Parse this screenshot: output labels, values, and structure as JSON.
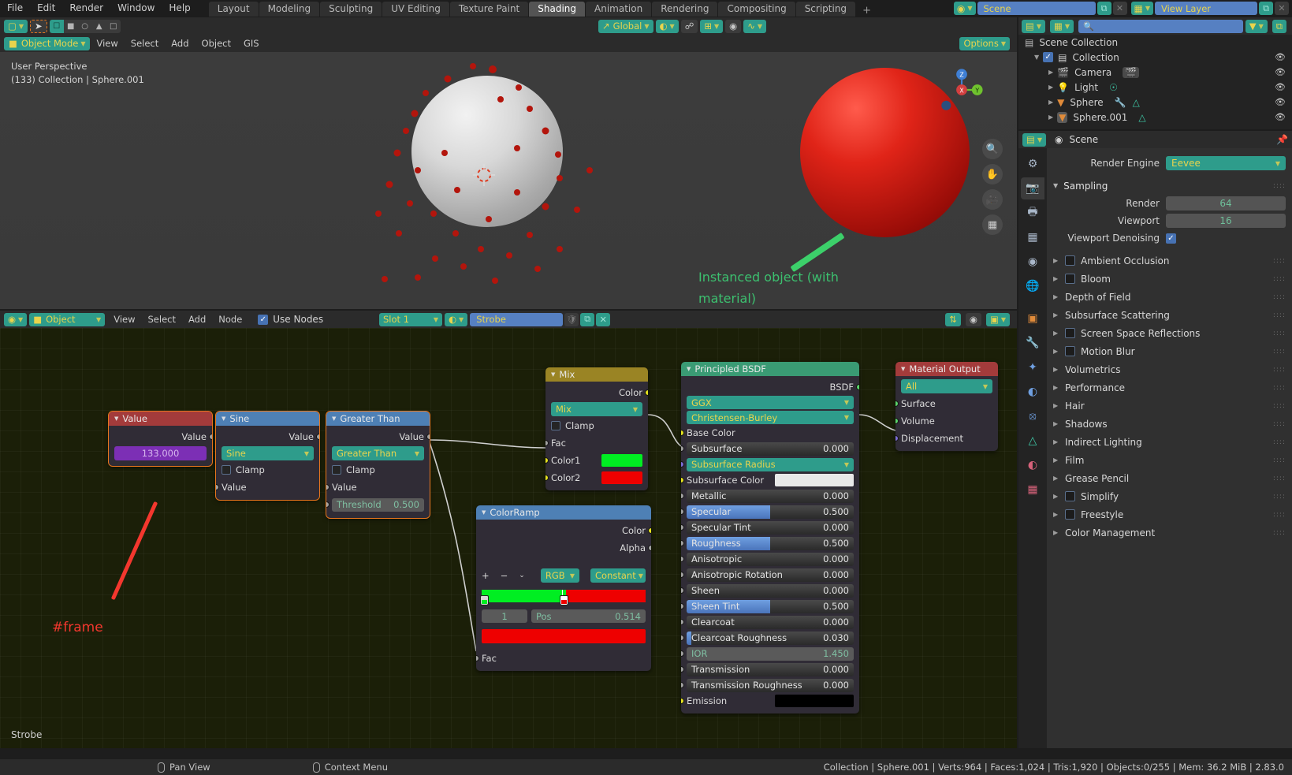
{
  "topbar": {
    "menus": [
      "File",
      "Edit",
      "Render",
      "Window",
      "Help"
    ],
    "workspaces": [
      "Layout",
      "Modeling",
      "Sculpting",
      "UV Editing",
      "Texture Paint",
      "Shading",
      "Animation",
      "Rendering",
      "Compositing",
      "Scripting"
    ],
    "active_workspace": "Shading",
    "add_workspace": "+",
    "scene_name": "Scene",
    "view_layer_name": "View Layer",
    "scene_icon": "scene-icon",
    "view_layer_icon": "view-layer-icon",
    "copy_icon": "duplicate-icon",
    "close_icon": "close-icon"
  },
  "viewport": {
    "header": {
      "editor_type_icon": "editor-type-3dview-icon",
      "cursor_icon": "select-cursor-icon",
      "select_modes": [
        "tweak-icon",
        "box-select-icon",
        "circle-select-icon",
        "lasso-select-icon",
        "select-extend-icon"
      ],
      "transform_orientation": "Global",
      "pivot_icon": "pivot-point-icon",
      "snap_icon": "snap-magnet-icon",
      "snap_target_icon": "snap-target-icon",
      "proportional_icon": "proportional-edit-icon",
      "proportional_falloff_icon": "falloff-curve-icon",
      "options_label": "Options",
      "visibility_icon": "object-visibility-icon",
      "gizmo_icon": "gizmo-icon",
      "overlays_icon": "overlays-icon",
      "xray_icon": "xray-toggle-icon",
      "shading_modes": [
        "wireframe-shading-icon",
        "solid-shading-icon",
        "material-preview-icon",
        "rendered-shading-icon"
      ]
    },
    "header2": {
      "mode": "Object Mode",
      "menus": [
        "View",
        "Select",
        "Add",
        "Object",
        "GIS"
      ]
    },
    "info_line1": "User Perspective",
    "info_line2": "(133) Collection | Sphere.001",
    "annotation": "Instanced object (with material)",
    "annotation_color": "#3cc06f",
    "gizmo_axes": [
      "Z",
      "Y",
      "X"
    ],
    "side_buttons": [
      "zoom-icon",
      "pan-hand-icon",
      "camera-view-icon",
      "ortho-persp-icon"
    ]
  },
  "shader_editor": {
    "header": {
      "editor_type_icon": "editor-type-shader-icon",
      "shader_type": "Object",
      "menus": [
        "View",
        "Select",
        "Add",
        "Node"
      ],
      "use_nodes_label": "Use Nodes",
      "use_nodes_checked": true,
      "slot": "Slot 1",
      "material_icon": "material-icon",
      "material_name": "Strobe",
      "shield_icon": "fake-user-icon",
      "new_material_icon": "new-material-icon",
      "unlink_icon": "unlink-icon",
      "snap_icon": "snap-icon",
      "overlay_icon": "node-overlay-icon",
      "pin_icon": "pin-icon"
    },
    "footer_label": "Strobe",
    "annotation_text": "#frame",
    "annotation_color": "#f4372e",
    "nodes": [
      {
        "name": "Value",
        "header_color": "#a33b3b",
        "selected": true,
        "outputs": [
          {
            "label": "Value",
            "socket": "grey"
          }
        ],
        "value_field": "133.000"
      },
      {
        "name": "Sine",
        "header_color": "#4e80b5",
        "selected": true,
        "outputs": [
          {
            "label": "Value",
            "socket": "grey"
          }
        ],
        "operation": "Sine",
        "clamp_label": "Clamp",
        "clamp_checked": false,
        "inputs": [
          {
            "label": "Value",
            "socket": "grey"
          }
        ]
      },
      {
        "name": "Greater Than",
        "header_color": "#4e80b5",
        "selected": true,
        "outputs": [
          {
            "label": "Value",
            "socket": "grey"
          }
        ],
        "operation": "Greater Than",
        "clamp_label": "Clamp",
        "clamp_checked": false,
        "inputs": [
          {
            "label": "Value",
            "socket": "grey"
          }
        ],
        "threshold_label": "Threshold",
        "threshold_value": "0.500"
      },
      {
        "name": "Mix",
        "header_color": "#9a8424",
        "selected": false,
        "outputs": [
          {
            "label": "Color",
            "socket": "yellow"
          }
        ],
        "blend_mode": "Mix",
        "clamp_label": "Clamp",
        "clamp_checked": false,
        "inputs": [
          {
            "label": "Fac",
            "socket": "grey"
          },
          {
            "label": "Color1",
            "socket": "yellow",
            "color": "#00ee22"
          },
          {
            "label": "Color2",
            "socket": "yellow",
            "color": "#ee0000"
          }
        ]
      },
      {
        "name": "ColorRamp",
        "header_color": "#4e80b5",
        "selected": false,
        "outputs": [
          {
            "label": "Color",
            "socket": "yellow"
          },
          {
            "label": "Alpha",
            "socket": "grey"
          }
        ],
        "tools": [
          "+",
          "−",
          "⌄"
        ],
        "color_mode": "RGB",
        "interpolation": "Constant",
        "stop_index": "1",
        "pos_label": "Pos",
        "pos_value": "0.514",
        "stop_color": "#ee0000",
        "ramp_left_color": "#00ee22",
        "ramp_right_color": "#ee0000",
        "ramp_split": 0.514,
        "inputs": [
          {
            "label": "Fac",
            "socket": "grey"
          }
        ]
      },
      {
        "name": "Principled BSDF",
        "header_color": "#3a9b74",
        "selected": false,
        "outputs": [
          {
            "label": "BSDF",
            "socket": "green"
          }
        ],
        "distribution": "GGX",
        "subsurface_method": "Christensen-Burley",
        "properties": [
          {
            "label": "Base Color",
            "type": "socket",
            "socket": "yellow"
          },
          {
            "label": "Subsurface",
            "type": "slider",
            "value": "0.000",
            "fill": 0.0,
            "socket": "grey"
          },
          {
            "label": "Subsurface Radius",
            "type": "teal",
            "socket": "purple"
          },
          {
            "label": "Subsurface Color",
            "type": "swatch",
            "color": "#e8e8e8",
            "socket": "yellow"
          },
          {
            "label": "Metallic",
            "type": "slider",
            "value": "0.000",
            "fill": 0.0,
            "socket": "grey"
          },
          {
            "label": "Specular",
            "type": "slider",
            "value": "0.500",
            "fill": 0.5,
            "socket": "grey"
          },
          {
            "label": "Specular Tint",
            "type": "slider",
            "value": "0.000",
            "fill": 0.0,
            "socket": "grey"
          },
          {
            "label": "Roughness",
            "type": "slider",
            "value": "0.500",
            "fill": 0.5,
            "socket": "grey"
          },
          {
            "label": "Anisotropic",
            "type": "slider",
            "value": "0.000",
            "fill": 0.0,
            "socket": "grey"
          },
          {
            "label": "Anisotropic Rotation",
            "type": "slider",
            "value": "0.000",
            "fill": 0.0,
            "socket": "grey"
          },
          {
            "label": "Sheen",
            "type": "slider",
            "value": "0.000",
            "fill": 0.0,
            "socket": "grey"
          },
          {
            "label": "Sheen Tint",
            "type": "slider",
            "value": "0.500",
            "fill": 0.5,
            "socket": "grey"
          },
          {
            "label": "Clearcoat",
            "type": "slider",
            "value": "0.000",
            "fill": 0.0,
            "socket": "grey"
          },
          {
            "label": "Clearcoat Roughness",
            "type": "slider",
            "value": "0.030",
            "fill": 0.03,
            "socket": "grey"
          },
          {
            "label": "IOR",
            "type": "disabled",
            "value": "1.450",
            "socket": "grey"
          },
          {
            "label": "Transmission",
            "type": "slider",
            "value": "0.000",
            "fill": 0.0,
            "socket": "grey"
          },
          {
            "label": "Transmission Roughness",
            "type": "slider",
            "value": "0.000",
            "fill": 0.0,
            "socket": "grey"
          },
          {
            "label": "Emission",
            "type": "swatch",
            "color": "#000000",
            "socket": "yellow"
          }
        ]
      },
      {
        "name": "Material Output",
        "header_color": "#a33b3b",
        "selected": false,
        "target": "All",
        "inputs": [
          {
            "label": "Surface",
            "socket": "green"
          },
          {
            "label": "Volume",
            "socket": "green"
          },
          {
            "label": "Displacement",
            "socket": "purple"
          }
        ]
      }
    ]
  },
  "outliner": {
    "header": {
      "editor_icon": "editor-type-outliner-icon",
      "display_mode_icon": "display-mode-icon",
      "search_placeholder": "",
      "filter_icon": "filter-funnel-icon",
      "new_collection_icon": "new-collection-icon"
    },
    "rows": [
      {
        "label": "Scene Collection",
        "indent": 0,
        "icon": "scene-collection-icon",
        "has_disclosure": false,
        "has_checkbox": false,
        "has_eye": false
      },
      {
        "label": "Collection",
        "indent": 1,
        "icon": "collection-icon",
        "has_disclosure": true,
        "has_checkbox": true,
        "has_eye": true
      },
      {
        "label": "Camera",
        "indent": 2,
        "icon": "camera-data-icon",
        "has_disclosure": true,
        "has_checkbox": false,
        "has_eye": true,
        "extra_icons": [
          "camera-object-data-icon"
        ]
      },
      {
        "label": "Light",
        "indent": 2,
        "icon": "light-data-icon",
        "has_disclosure": true,
        "has_checkbox": false,
        "has_eye": true,
        "extra_icons": [
          "light-object-data-icon"
        ]
      },
      {
        "label": "Sphere",
        "indent": 2,
        "icon": "mesh-object-icon",
        "has_disclosure": true,
        "has_checkbox": false,
        "has_eye": true,
        "extra_icons": [
          "modifier-wrench-icon",
          "mesh-data-icon"
        ]
      },
      {
        "label": "Sphere.001",
        "indent": 2,
        "icon": "mesh-object-icon",
        "has_disclosure": true,
        "has_checkbox": false,
        "has_eye": true,
        "extra_icons": [
          "mesh-data-icon"
        ]
      }
    ]
  },
  "properties": {
    "header": {
      "editor_icon": "editor-type-properties-icon",
      "breadcrumb_icon": "scene-icon",
      "breadcrumb": "Scene",
      "pin_icon": "pin-icon"
    },
    "tabs": [
      {
        "name": "tool-icon",
        "active": false
      },
      {
        "name": "render-properties-icon",
        "active": true
      },
      {
        "name": "output-properties-icon",
        "active": false
      },
      {
        "name": "view-layer-properties-icon",
        "active": false
      },
      {
        "name": "scene-properties-icon",
        "active": false
      },
      {
        "name": "world-properties-icon",
        "active": false
      },
      {
        "name": "object-properties-icon",
        "active": false
      },
      {
        "name": "modifier-properties-icon",
        "active": false
      },
      {
        "name": "particle-properties-icon",
        "active": false
      },
      {
        "name": "physics-properties-icon",
        "active": false
      },
      {
        "name": "constraint-properties-icon",
        "active": false
      },
      {
        "name": "object-data-properties-icon",
        "active": false
      },
      {
        "name": "material-properties-icon",
        "active": false
      },
      {
        "name": "texture-properties-icon",
        "active": false
      }
    ],
    "render_engine_label": "Render Engine",
    "render_engine_value": "Eevee",
    "sampling": {
      "title": "Sampling",
      "render_label": "Render",
      "render_value": "64",
      "viewport_label": "Viewport",
      "viewport_value": "16",
      "denoise_label": "Viewport Denoising",
      "denoise_checked": true
    },
    "panels": [
      {
        "label": "Ambient Occlusion",
        "checkbox": true,
        "checked": false
      },
      {
        "label": "Bloom",
        "checkbox": true,
        "checked": false
      },
      {
        "label": "Depth of Field",
        "checkbox": false
      },
      {
        "label": "Subsurface Scattering",
        "checkbox": false
      },
      {
        "label": "Screen Space Reflections",
        "checkbox": true,
        "checked": false
      },
      {
        "label": "Motion Blur",
        "checkbox": true,
        "checked": false
      },
      {
        "label": "Volumetrics",
        "checkbox": false
      },
      {
        "label": "Performance",
        "checkbox": false
      },
      {
        "label": "Hair",
        "checkbox": false
      },
      {
        "label": "Shadows",
        "checkbox": false
      },
      {
        "label": "Indirect Lighting",
        "checkbox": false
      },
      {
        "label": "Film",
        "checkbox": false
      },
      {
        "label": "Grease Pencil",
        "checkbox": false
      },
      {
        "label": "Simplify",
        "checkbox": true,
        "checked": false
      },
      {
        "label": "Freestyle",
        "checkbox": true,
        "checked": false
      },
      {
        "label": "Color Management",
        "checkbox": false
      }
    ]
  },
  "statusbar": {
    "items": [
      {
        "icon": "mouse-middle-icon",
        "label": "Pan View"
      },
      {
        "icon": "mouse-right-icon",
        "label": "Context Menu"
      }
    ],
    "stats": "Collection | Sphere.001 | Verts:964 | Faces:1,024 | Tris:1,920 | Objects:0/255 | Mem: 36.2 MiB | 2.83.0"
  }
}
